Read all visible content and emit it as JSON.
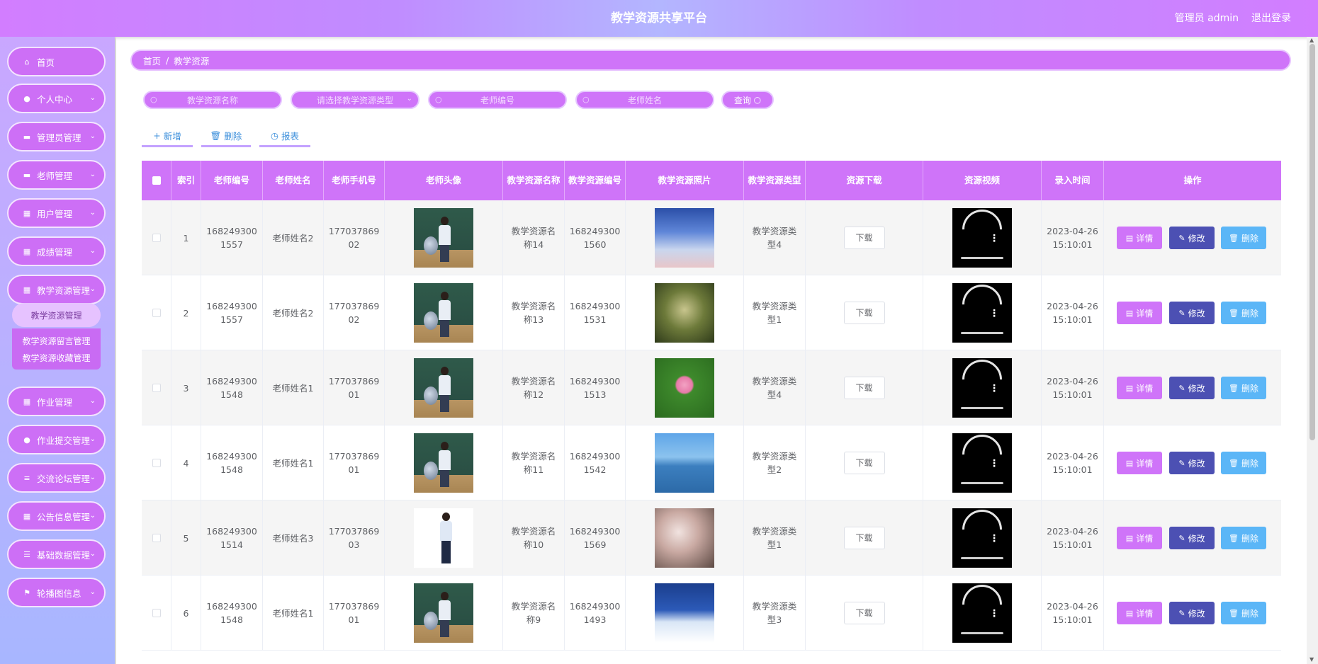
{
  "header": {
    "title": "教学资源共享平台",
    "user": "管理员 admin",
    "logout": "退出登录"
  },
  "sidebar": {
    "items": [
      {
        "label": "首页",
        "icon": "home-icon"
      },
      {
        "label": "个人中心",
        "icon": "user-icon"
      },
      {
        "label": "管理员管理",
        "icon": "monitor-icon"
      },
      {
        "label": "老师管理",
        "icon": "monitor-icon"
      },
      {
        "label": "用户管理",
        "icon": "grid-icon"
      },
      {
        "label": "成绩管理",
        "icon": "grid-icon"
      },
      {
        "label": "教学资源管理",
        "icon": "grid-icon"
      },
      {
        "label": "作业管理",
        "icon": "grid-icon"
      },
      {
        "label": "作业提交管理",
        "icon": "location-icon"
      },
      {
        "label": "交流论坛管理",
        "icon": "sliders-icon"
      },
      {
        "label": "公告信息管理",
        "icon": "grid-icon"
      },
      {
        "label": "基础数据管理",
        "icon": "list-icon"
      },
      {
        "label": "轮播图信息",
        "icon": "flag-icon"
      }
    ],
    "submenu": [
      "教学资源管理",
      "教学资源留言管理",
      "教学资源收藏管理"
    ]
  },
  "breadcrumb": {
    "home": "首页",
    "sep": "/",
    "current": "教学资源"
  },
  "search": {
    "name_placeholder": "教学资源名称",
    "type_placeholder": "请选择教学资源类型",
    "teacher_no_placeholder": "老师编号",
    "teacher_name_placeholder": "老师姓名",
    "query_label": "查询"
  },
  "actions": {
    "add": "新增",
    "delete": "删除",
    "report": "报表"
  },
  "table": {
    "headers": [
      "索引",
      "老师编号",
      "老师姓名",
      "老师手机号",
      "老师头像",
      "教学资源名称",
      "教学资源编号",
      "教学资源照片",
      "教学资源类型",
      "资源下载",
      "资源视频",
      "录入时间",
      "操作"
    ],
    "download_label": "下载",
    "detail_label": "详情",
    "edit_label": "修改",
    "delete_label": "删除",
    "rows": [
      {
        "index": "1",
        "teacher_no": "1682493001557",
        "teacher_name": "老师姓名2",
        "phone": "17703786902",
        "avatar": "teacher-female",
        "name": "教学资源名称14",
        "code": "1682493001560",
        "photo": "sky",
        "type": "教学资源类型4",
        "time": "2023-04-26 15:10:01"
      },
      {
        "index": "2",
        "teacher_no": "1682493001557",
        "teacher_name": "老师姓名2",
        "phone": "17703786902",
        "avatar": "teacher-female",
        "name": "教学资源名称13",
        "code": "1682493001531",
        "photo": "forest",
        "type": "教学资源类型1",
        "time": "2023-04-26 15:10:01"
      },
      {
        "index": "3",
        "teacher_no": "1682493001548",
        "teacher_name": "老师姓名1",
        "phone": "17703786901",
        "avatar": "teacher-female",
        "name": "教学资源名称12",
        "code": "1682493001513",
        "photo": "lotus",
        "type": "教学资源类型4",
        "time": "2023-04-26 15:10:01"
      },
      {
        "index": "4",
        "teacher_no": "1682493001548",
        "teacher_name": "老师姓名1",
        "phone": "17703786901",
        "avatar": "teacher-female",
        "name": "教学资源名称11",
        "code": "1682493001542",
        "photo": "lake",
        "type": "教学资源类型2",
        "time": "2023-04-26 15:10:01"
      },
      {
        "index": "5",
        "teacher_no": "1682493001514",
        "teacher_name": "老师姓名3",
        "phone": "17703786903",
        "avatar": "teacher-male",
        "name": "教学资源名称10",
        "code": "1682493001569",
        "photo": "blossom",
        "type": "教学资源类型1",
        "time": "2023-04-26 15:10:01"
      },
      {
        "index": "6",
        "teacher_no": "1682493001548",
        "teacher_name": "老师姓名1",
        "phone": "17703786901",
        "avatar": "teacher-female",
        "name": "教学资源名称9",
        "code": "1682493001493",
        "photo": "snow",
        "type": "教学资源类型3",
        "time": "2023-04-26 15:10:01"
      }
    ]
  },
  "colors": {
    "primary": "#cf74f9",
    "edit": "#4c50b3",
    "delete": "#5bb6f7",
    "link": "#3a8edb"
  }
}
